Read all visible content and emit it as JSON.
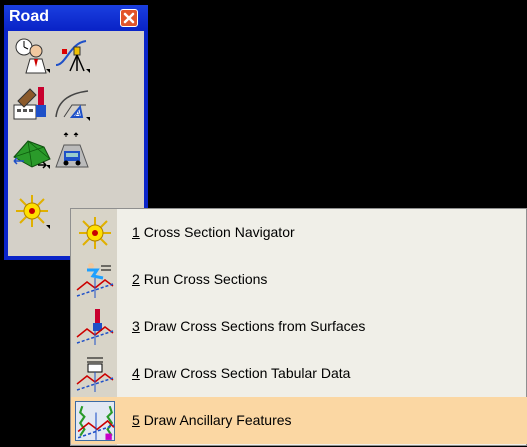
{
  "toolbox": {
    "title": "Road",
    "close_icon": "close-icon",
    "tools": [
      {
        "name": "project-manager-icon"
      },
      {
        "name": "survey-instrument-icon"
      },
      {
        "name": "road-design-toolkit-icon"
      },
      {
        "name": "alignment-curve-icon"
      },
      {
        "name": "terrain-model-icon"
      },
      {
        "name": "vehicle-corridor-icon"
      },
      {
        "name": "cross-section-flyout-icon"
      }
    ]
  },
  "menu": {
    "items": [
      {
        "num": "1",
        "label": "Cross Section Navigator",
        "icon": "cross-section-navigator-icon",
        "highlighted": false
      },
      {
        "num": "2",
        "label": "Run Cross Sections",
        "icon": "run-cross-sections-icon",
        "highlighted": false
      },
      {
        "num": "3",
        "label": "Draw Cross Sections from Surfaces",
        "icon": "draw-cross-sections-surfaces-icon",
        "highlighted": false
      },
      {
        "num": "4",
        "label": "Draw Cross Section Tabular Data",
        "icon": "draw-tabular-data-icon",
        "highlighted": false
      },
      {
        "num": "5",
        "label": "Draw Ancillary Features",
        "icon": "draw-ancillary-features-icon",
        "highlighted": true
      }
    ]
  },
  "colors": {
    "titlebar": "#0a24c8",
    "panel": "#d4d0c8",
    "menu_highlight": "#fbd7a3",
    "close_button": "#e2542a"
  }
}
